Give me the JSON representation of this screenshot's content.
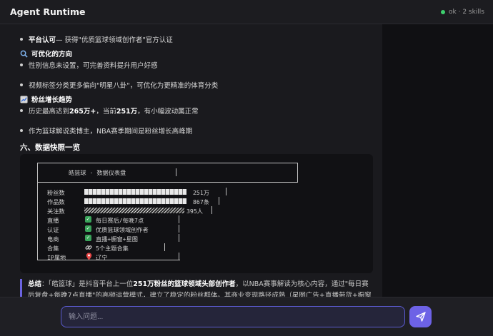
{
  "app": {
    "title": "Agent Runtime",
    "status": "ok · 2 skills",
    "status_color": "#3ecf6e"
  },
  "content": {
    "line1": {
      "label": "平台认可",
      "text": " — 获得\"优质篮球领域创作者\"官方认证"
    },
    "opt_heading": "可优化的方向",
    "opt_items": [
      "性别信息未设置，可完善资料提升用户好感",
      "视频标签分类更多偏向\"明星八卦\"，可优化为更精准的体育分类"
    ],
    "fans_heading": "粉丝增长趋势",
    "fans_item1": {
      "a": "历史最高达到 ",
      "b": "265万+",
      "c": "，当前 ",
      "d": "251万",
      "e": "，有小幅波动属正常"
    },
    "fans_item2": "作为篮球解说类博主，NBA赛季期间是粉丝增长高峰期",
    "section_title": "六、数据快照一览",
    "snapshot": {
      "title": "皓篮球 · 数据仪表盘",
      "rows": [
        {
          "label": "粉丝数",
          "value": "251万"
        },
        {
          "label": "作品数",
          "value": "867条"
        },
        {
          "label": "关注数",
          "value": "395人"
        }
      ],
      "info": [
        {
          "label": "直播",
          "icon": "check-icon",
          "value": "每日赛后/每晚7点"
        },
        {
          "label": "认证",
          "icon": "check-icon",
          "value": "优质篮球领域创作者"
        },
        {
          "label": "电商",
          "icon": "check-icon",
          "value": "直播+橱窗+星图"
        },
        {
          "label": "合集",
          "icon": "link-icon",
          "value": "5个主题合集"
        },
        {
          "label": "IP属地",
          "icon": "pin-icon",
          "value": "辽宁"
        }
      ]
    },
    "summary": {
      "label": "总结",
      "p1": "：「皓篮球」是抖音平台上一位",
      "bold": "251万粉丝的篮球领域头部创作者",
      "p2": "，以NBA赛事解读为核心内容，通过\"每日赛后复盘+每晚7点直播\"的高频运营模式，建立了稳定的粉丝群体。其商业变现路径成熟（星图广告+直播带货+橱窗+私"
    }
  },
  "input": {
    "placeholder": "输入问题..."
  },
  "colors": {
    "accent": "#6d62e6",
    "check": "#3aa35a"
  }
}
